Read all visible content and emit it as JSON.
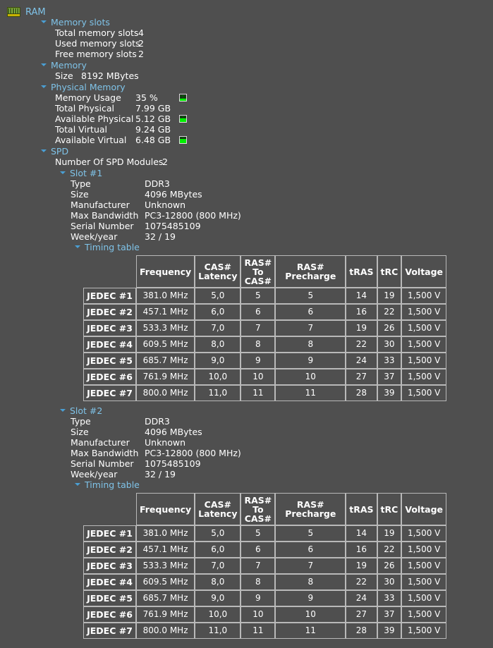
{
  "window": {
    "title": "RAM",
    "root_icon": "ram-module-icon"
  },
  "sections": {
    "memory_slots": {
      "label": "Memory slots",
      "rows": [
        {
          "key": "Total memory slots",
          "value": "4"
        },
        {
          "key": "Used memory slots",
          "value": "2"
        },
        {
          "key": "Free memory slots",
          "value": "2"
        }
      ]
    },
    "memory": {
      "label": "Memory",
      "rows": [
        {
          "key": "Size",
          "value": "8192 MBytes"
        }
      ]
    },
    "physical_memory": {
      "label": "Physical Memory",
      "rows": [
        {
          "key": "Memory Usage",
          "value": "35 %",
          "gauge": 35
        },
        {
          "key": "Total Physical",
          "value": "7.99 GB",
          "gauge": null
        },
        {
          "key": "Available Physical",
          "value": "5.12 GB",
          "gauge": 64
        },
        {
          "key": "Total Virtual",
          "value": "9.24 GB",
          "gauge": null
        },
        {
          "key": "Available Virtual",
          "value": "6.48 GB",
          "gauge": 70
        }
      ]
    },
    "spd": {
      "label": "SPD",
      "modules_row": {
        "key": "Number Of SPD Modules",
        "value": "2"
      },
      "slots": [
        {
          "label": "Slot #1",
          "rows": [
            {
              "key": "Type",
              "value": "DDR3"
            },
            {
              "key": "Size",
              "value": "4096 MBytes"
            },
            {
              "key": "Manufacturer",
              "value": "Unknown"
            },
            {
              "key": "Max Bandwidth",
              "value": "PC3-12800 (800 MHz)"
            },
            {
              "key": "Serial Number",
              "value": "1075485109"
            },
            {
              "key": "Week/year",
              "value": "32 / 19"
            }
          ],
          "timing_table": {
            "label": "Timing table",
            "columns": [
              "",
              "Frequency",
              "CAS# Latency",
              "RAS# To CAS#",
              "RAS# Precharge",
              "tRAS",
              "tRC",
              "Voltage"
            ],
            "rows": [
              [
                "JEDEC #1",
                "381.0 MHz",
                "5,0",
                "5",
                "5",
                "14",
                "19",
                "1,500 V"
              ],
              [
                "JEDEC #2",
                "457.1 MHz",
                "6,0",
                "6",
                "6",
                "16",
                "22",
                "1,500 V"
              ],
              [
                "JEDEC #3",
                "533.3 MHz",
                "7,0",
                "7",
                "7",
                "19",
                "26",
                "1,500 V"
              ],
              [
                "JEDEC #4",
                "609.5 MHz",
                "8,0",
                "8",
                "8",
                "22",
                "30",
                "1,500 V"
              ],
              [
                "JEDEC #5",
                "685.7 MHz",
                "9,0",
                "9",
                "9",
                "24",
                "33",
                "1,500 V"
              ],
              [
                "JEDEC #6",
                "761.9 MHz",
                "10,0",
                "10",
                "10",
                "27",
                "37",
                "1,500 V"
              ],
              [
                "JEDEC #7",
                "800.0 MHz",
                "11,0",
                "11",
                "11",
                "28",
                "39",
                "1,500 V"
              ]
            ]
          }
        },
        {
          "label": "Slot #2",
          "rows": [
            {
              "key": "Type",
              "value": "DDR3"
            },
            {
              "key": "Size",
              "value": "4096 MBytes"
            },
            {
              "key": "Manufacturer",
              "value": "Unknown"
            },
            {
              "key": "Max Bandwidth",
              "value": "PC3-12800 (800 MHz)"
            },
            {
              "key": "Serial Number",
              "value": "1075485109"
            },
            {
              "key": "Week/year",
              "value": "32 / 19"
            }
          ],
          "timing_table": {
            "label": "Timing table",
            "columns": [
              "",
              "Frequency",
              "CAS# Latency",
              "RAS# To CAS#",
              "RAS# Precharge",
              "tRAS",
              "tRC",
              "Voltage"
            ],
            "rows": [
              [
                "JEDEC #1",
                "381.0 MHz",
                "5,0",
                "5",
                "5",
                "14",
                "19",
                "1,500 V"
              ],
              [
                "JEDEC #2",
                "457.1 MHz",
                "6,0",
                "6",
                "6",
                "16",
                "22",
                "1,500 V"
              ],
              [
                "JEDEC #3",
                "533.3 MHz",
                "7,0",
                "7",
                "7",
                "19",
                "26",
                "1,500 V"
              ],
              [
                "JEDEC #4",
                "609.5 MHz",
                "8,0",
                "8",
                "8",
                "22",
                "30",
                "1,500 V"
              ],
              [
                "JEDEC #5",
                "685.7 MHz",
                "9,0",
                "9",
                "9",
                "24",
                "33",
                "1,500 V"
              ],
              [
                "JEDEC #6",
                "761.9 MHz",
                "10,0",
                "10",
                "10",
                "27",
                "37",
                "1,500 V"
              ],
              [
                "JEDEC #7",
                "800.0 MHz",
                "11,0",
                "11",
                "11",
                "28",
                "39",
                "1,500 V"
              ]
            ]
          }
        }
      ]
    }
  },
  "colors": {
    "background": "#4f4f4f",
    "node_label": "#7fc3e8",
    "caret": "#4a9fd4",
    "text": "#ffffff",
    "table_border": "#b9b9b9",
    "gauge_green": "#00f000"
  }
}
